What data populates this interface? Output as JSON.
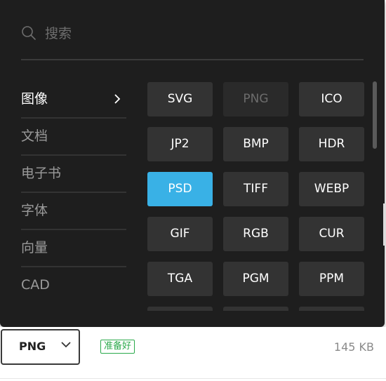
{
  "search": {
    "placeholder": "搜索",
    "icon": "search-icon"
  },
  "categories": [
    {
      "label": "图像",
      "active": true
    },
    {
      "label": "文档",
      "active": false
    },
    {
      "label": "电子书",
      "active": false
    },
    {
      "label": "字体",
      "active": false
    },
    {
      "label": "向量",
      "active": false
    },
    {
      "label": "CAD",
      "active": false
    }
  ],
  "formats": [
    {
      "label": "SVG",
      "state": "normal"
    },
    {
      "label": "PNG",
      "state": "disabled"
    },
    {
      "label": "ICO",
      "state": "normal"
    },
    {
      "label": "JP2",
      "state": "normal"
    },
    {
      "label": "BMP",
      "state": "normal"
    },
    {
      "label": "HDR",
      "state": "normal"
    },
    {
      "label": "PSD",
      "state": "selected"
    },
    {
      "label": "TIFF",
      "state": "normal"
    },
    {
      "label": "WEBP",
      "state": "normal"
    },
    {
      "label": "GIF",
      "state": "normal"
    },
    {
      "label": "RGB",
      "state": "normal"
    },
    {
      "label": "CUR",
      "state": "normal"
    },
    {
      "label": "TGA",
      "state": "normal"
    },
    {
      "label": "PGM",
      "state": "normal"
    },
    {
      "label": "PPM",
      "state": "normal"
    }
  ],
  "bottom": {
    "select_value": "PNG",
    "status": "准备好",
    "file_size": "145 KB"
  },
  "colors": {
    "panel": "#1e1e1e",
    "button": "#333333",
    "selected": "#39b1e6",
    "status_green": "#2aa94a"
  }
}
